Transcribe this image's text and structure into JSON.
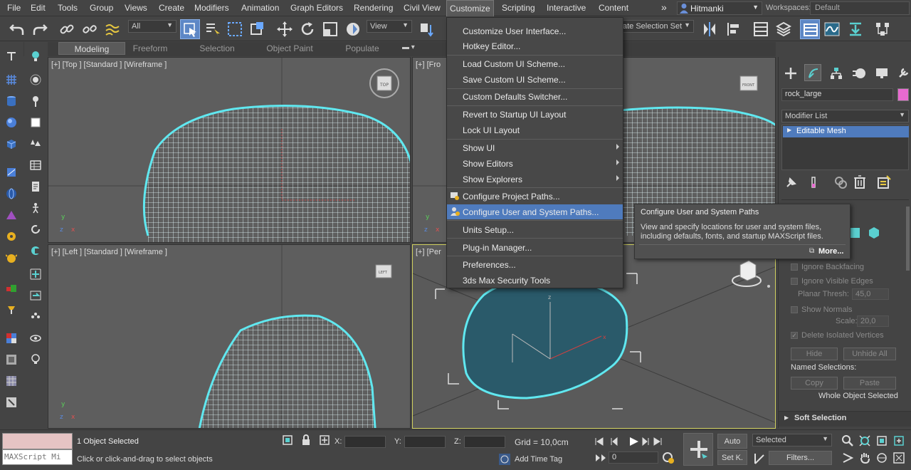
{
  "menubar": {
    "items": [
      "File",
      "Edit",
      "Tools",
      "Group",
      "Views",
      "Create",
      "Modifiers",
      "Animation",
      "Graph Editors",
      "Rendering",
      "Civil View",
      "Customize",
      "Scripting",
      "Interactive",
      "Content"
    ],
    "active": "Customize",
    "overflow": "»",
    "user": "Hitmanki",
    "workspaces_label": "Workspaces:",
    "workspace": "Default"
  },
  "toolbar": {
    "filter": "All",
    "refcoord": "View",
    "selection_set": "ate Selection Set"
  },
  "ribbon": {
    "tabs": [
      "Modeling",
      "Freeform",
      "Selection",
      "Object Paint",
      "Populate"
    ],
    "active": "Modeling"
  },
  "viewports": {
    "top": "[+] [Top ] [Standard ] [Wireframe ]",
    "front": "[+] [Fro",
    "left": "[+] [Left ] [Standard ] [Wireframe ]",
    "persp": "[+] [Per",
    "cube_top": "TOP",
    "cube_front": "FRONT",
    "cube_left": "LEFT"
  },
  "customize_menu": {
    "items": [
      {
        "label": "Customize User Interface..."
      },
      {
        "label": "Hotkey Editor..."
      },
      {
        "label": "Load Custom UI Scheme..."
      },
      {
        "label": "Save Custom UI Scheme..."
      },
      {
        "label": "Custom Defaults Switcher..."
      },
      {
        "label": "Revert to Startup UI Layout"
      },
      {
        "label": "Lock UI Layout"
      },
      {
        "label": "Show UI"
      },
      {
        "label": "Show Editors"
      },
      {
        "label": "Show Explorers"
      },
      {
        "label": "Configure Project Paths..."
      },
      {
        "label": "Configure User and System Paths..."
      },
      {
        "label": "Units Setup..."
      },
      {
        "label": "Plug-in Manager..."
      },
      {
        "label": "Preferences..."
      },
      {
        "label": "3ds Max Security Tools"
      }
    ]
  },
  "tooltip": {
    "title": "Configure User and System Paths",
    "body_line1": "View and specify locations for user and system files,",
    "body_line2": "including defaults, fonts, and startup MAXScript files.",
    "more": "More..."
  },
  "command_panel": {
    "object_name": "rock_large",
    "object_color": "#e86ad0",
    "modifier_list": "Modifier List",
    "stack_item": "Editable Mesh",
    "ignore_backfacing": "Ignore Backfacing",
    "ignore_visible_edges": "Ignore Visible Edges",
    "planar_thresh_label": "Planar Thresh:",
    "planar_thresh_value": "45,0",
    "show_normals": "Show Normals",
    "scale_label": "Scale:",
    "scale_value": "20,0",
    "delete_isolated": "Delete Isolated Vertices",
    "hide": "Hide",
    "unhide_all": "Unhide All",
    "named_selections": "Named Selections:",
    "copy": "Copy",
    "paste": "Paste",
    "whole_object": "Whole Object Selected",
    "soft_selection": "Soft Selection"
  },
  "statusbar": {
    "maxscript": "MAXScript Mi",
    "objects_selected": "1 Object Selected",
    "prompt": "Click or click-and-drag to select objects",
    "x_label": "X:",
    "y_label": "Y:",
    "z_label": "Z:",
    "grid": "Grid = 10,0cm",
    "add_time_tag": "Add Time Tag",
    "frame": "0",
    "auto": "Auto",
    "set_key": "Set K.",
    "selected": "Selected",
    "filters": "Filters..."
  },
  "colors": {
    "bg": "#444444",
    "viewport": "#5e5e5e",
    "highlight": "#4f7bbd",
    "wire": "#e8ffff",
    "selection": "#60e8f0",
    "persp_fill": "#2a5a6a"
  }
}
